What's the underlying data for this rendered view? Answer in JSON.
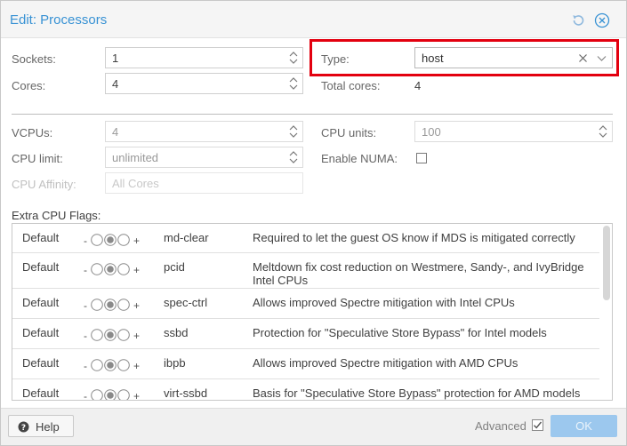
{
  "window": {
    "title": "Edit: Processors",
    "accent": "#3892d4"
  },
  "titlebar": {
    "reset_icon": "reset-icon",
    "close_icon": "close-circle-icon"
  },
  "form": {
    "sockets": {
      "label": "Sockets:",
      "value": "1"
    },
    "cores": {
      "label": "Cores:",
      "value": "4"
    },
    "type": {
      "label": "Type:",
      "value": "host"
    },
    "total_cores": {
      "label": "Total cores:",
      "value": "4"
    },
    "vcpus": {
      "label": "VCPUs:",
      "value": "4"
    },
    "cpu_units": {
      "label": "CPU units:",
      "value": "100"
    },
    "cpu_limit": {
      "label": "CPU limit:",
      "value": "unlimited"
    },
    "enable_numa": {
      "label": "Enable NUMA:",
      "checked": false
    },
    "cpu_affinity": {
      "label": "CPU Affinity:",
      "placeholder": "All Cores"
    },
    "extra_flags_label": "Extra CPU Flags:"
  },
  "flags": [
    {
      "state": "Default",
      "name": "md-clear",
      "description": "Required to let the guest OS know if MDS is mitigated correctly"
    },
    {
      "state": "Default",
      "name": "pcid",
      "description": "Meltdown fix cost reduction on Westmere, Sandy-, and IvyBridge Intel CPUs"
    },
    {
      "state": "Default",
      "name": "spec-ctrl",
      "description": "Allows improved Spectre mitigation with Intel CPUs"
    },
    {
      "state": "Default",
      "name": "ssbd",
      "description": "Protection for \"Speculative Store Bypass\" for Intel models"
    },
    {
      "state": "Default",
      "name": "ibpb",
      "description": "Allows improved Spectre mitigation with AMD CPUs"
    },
    {
      "state": "Default",
      "name": "virt-ssbd",
      "description": "Basis for \"Speculative Store Bypass\" protection for AMD models"
    }
  ],
  "toggle": {
    "minus": "-",
    "plus": "+"
  },
  "footer": {
    "help_label": "Help",
    "advanced_label": "Advanced",
    "advanced_checked": true,
    "ok_label": "OK"
  },
  "highlight_color": "#e3000f"
}
